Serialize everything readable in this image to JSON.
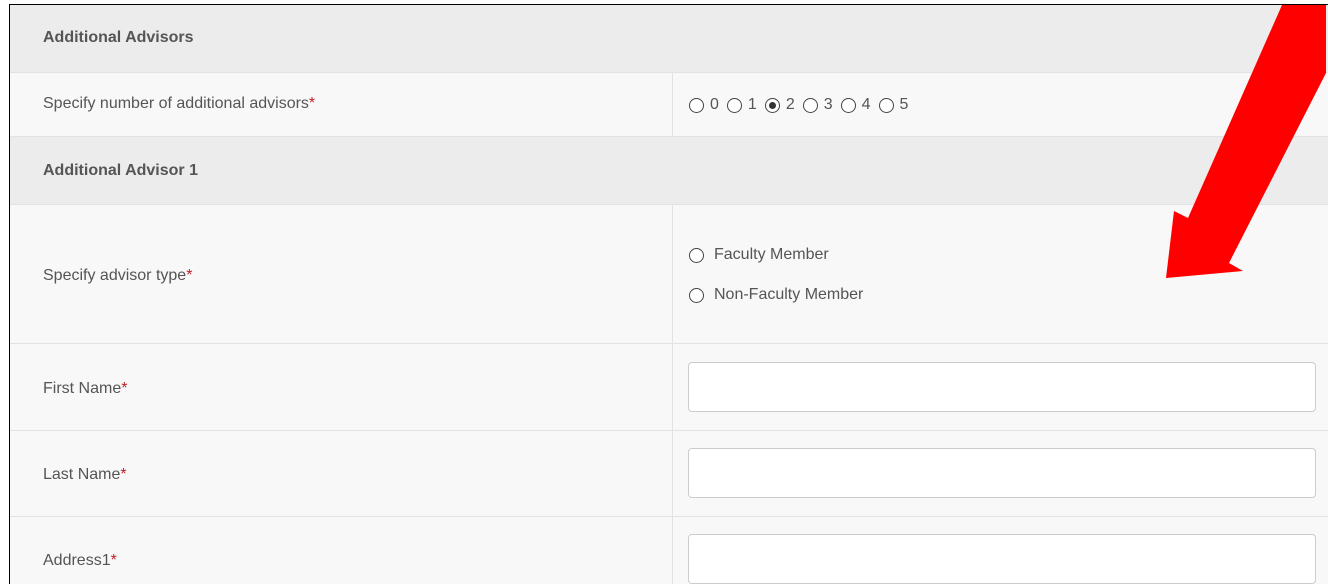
{
  "sections": {
    "additional_advisors": {
      "title": "Additional Advisors",
      "count_label": "Specify number of additional advisors",
      "required_mark": "*",
      "count_options": [
        "0",
        "1",
        "2",
        "3",
        "4",
        "5"
      ],
      "selected_count": "2"
    },
    "advisor1": {
      "title": "Additional Advisor 1",
      "type_label": "Specify advisor type",
      "type_options": [
        "Faculty Member",
        "Non-Faculty Member"
      ],
      "first_name_label": "First Name",
      "first_name_value": "",
      "last_name_label": "Last Name",
      "last_name_value": "",
      "address1_label": "Address1",
      "address1_value": "",
      "required_mark": "*"
    }
  },
  "annotation": {
    "arrow_color": "#ff0000",
    "arrow_icon": "red-arrow-icon"
  }
}
